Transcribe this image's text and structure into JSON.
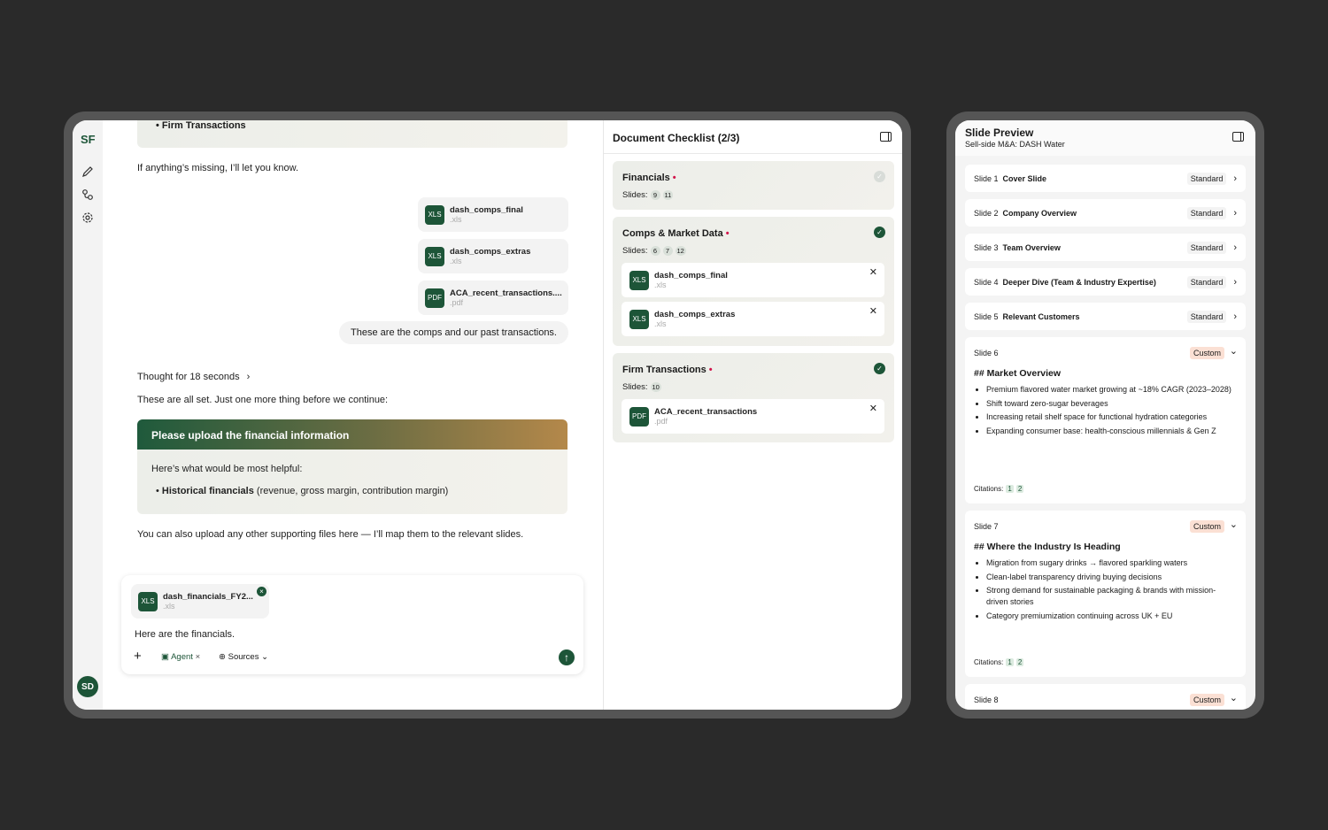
{
  "app": {
    "logo": "SF",
    "avatar": "SD"
  },
  "chat": {
    "top_bullet": "Firm Transactions",
    "missing_note": "If anything’s missing, I’ll let you know.",
    "attachments": [
      {
        "type": "XLS",
        "name": "dash_comps_final",
        "ext": ".xls"
      },
      {
        "type": "XLS",
        "name": "dash_comps_extras",
        "ext": ".xls"
      },
      {
        "type": "PDF",
        "name": "ACA_recent_transactions....",
        "ext": ".pdf"
      }
    ],
    "user_message": "These are the comps and our past transactions.",
    "thought": "Thought for 18 seconds",
    "all_set": "These are all set. Just one more thing before we continue:",
    "prompt_title": "Please upload the financial information",
    "prompt_intro": "Here’s what would be most helpful:",
    "prompt_bullet_bold": "Historical financials",
    "prompt_bullet_rest": " (revenue, gross margin, contribution margin)",
    "also_upload": "You can also upload any other supporting files here — I’ll map them to the relevant slides.",
    "composer": {
      "file": {
        "type": "XLS",
        "name": "dash_financials_FY2...",
        "ext": ".xls"
      },
      "text": "Here are the financials.",
      "agent": "Agent",
      "sources": "Sources"
    }
  },
  "checklist": {
    "title": "Document Checklist (2/3)",
    "slides_label": "Slides:",
    "sections": [
      {
        "title": "Financials",
        "slides": [
          "9",
          "11"
        ],
        "done": false,
        "files": []
      },
      {
        "title": "Comps & Market Data",
        "slides": [
          "6",
          "7",
          "12"
        ],
        "done": true,
        "files": [
          {
            "type": "XLS",
            "name": "dash_comps_final",
            "ext": ".xls"
          },
          {
            "type": "XLS",
            "name": "dash_comps_extras",
            "ext": ".xls"
          }
        ]
      },
      {
        "title": "Firm Transactions",
        "slides": [
          "10"
        ],
        "done": true,
        "files": [
          {
            "type": "PDF",
            "name": "ACA_recent_transactions",
            "ext": ".pdf"
          }
        ]
      }
    ]
  },
  "preview": {
    "title": "Slide Preview",
    "subtitle": "Sell-side M&A: DASH Water",
    "rows": [
      {
        "label": "Slide 1",
        "title": "Cover Slide",
        "tag": "Standard"
      },
      {
        "label": "Slide 2",
        "title": "Company Overview",
        "tag": "Standard"
      },
      {
        "label": "Slide 3",
        "title": "Team Overview",
        "tag": "Standard"
      },
      {
        "label": "Slide 4",
        "title": "Deeper Dive (Team & Industry Expertise)",
        "tag": "Standard"
      },
      {
        "label": "Slide 5",
        "title": "Relevant Customers",
        "tag": "Standard"
      }
    ],
    "cards": [
      {
        "label": "Slide 6",
        "tag": "Custom",
        "heading": "## Market Overview",
        "bullets": [
          "Premium flavored water market growing at ~18% CAGR (2023–2028)",
          "Shift toward zero-sugar beverages",
          "Increasing retail shelf space for functional hydration categories",
          "Expanding consumer base: health-conscious millennials & Gen Z"
        ],
        "citations_label": "Citations:",
        "citations": [
          "1",
          "2"
        ]
      },
      {
        "label": "Slide 7",
        "tag": "Custom",
        "heading": "## Where the Industry Is Heading",
        "bullets": [
          "Migration from sugary drinks → flavored sparkling waters",
          "Clean-label transparency driving buying decisions",
          "Strong demand for sustainable packaging & brands with mission-driven stories",
          "Category premiumization continuing across UK + EU"
        ],
        "citations_label": "Citations:",
        "citations": [
          "1",
          "2"
        ]
      },
      {
        "label": "Slide 8",
        "tag": "Custom"
      }
    ]
  }
}
